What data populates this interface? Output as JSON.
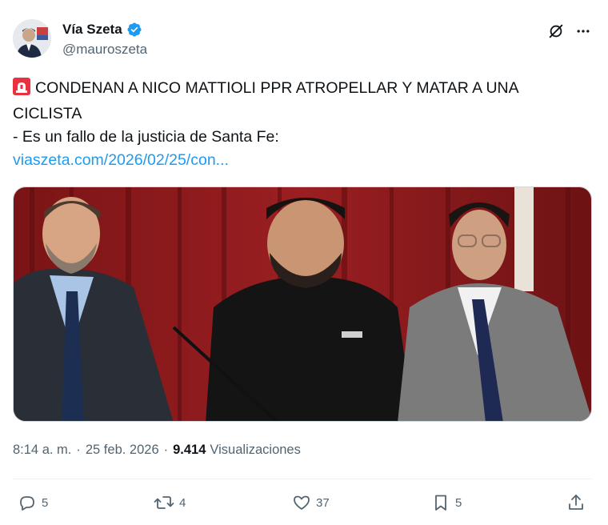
{
  "author": {
    "display_name": "Vía Szeta",
    "handle": "@mauroszeta",
    "verified": true
  },
  "post": {
    "headline_line1": "CONDENAN A NICO MATTIOLI PPR ATROPELLAR Y MATAR A UNA",
    "headline_line2": "CICLISTA",
    "subtitle": "- Es un fallo de la justicia de Santa Fe:",
    "link_text": "viaszeta.com/2026/02/25/con..."
  },
  "meta": {
    "time": "8:14 a. m.",
    "date": "25 feb. 2026",
    "views_count": "9.414",
    "views_label": "Visualizaciones"
  },
  "actions": {
    "replies": "5",
    "reposts": "4",
    "likes": "37",
    "bookmarks": "5"
  },
  "colors": {
    "text": "#0f1419",
    "secondary": "#536471",
    "link": "#1d9bf0",
    "verified": "#1d9bf0"
  },
  "icons": [
    "siren-icon",
    "verified-badge-icon",
    "grok-icon",
    "more-icon",
    "reply-icon",
    "retweet-icon",
    "like-icon",
    "bookmark-icon",
    "share-icon"
  ]
}
